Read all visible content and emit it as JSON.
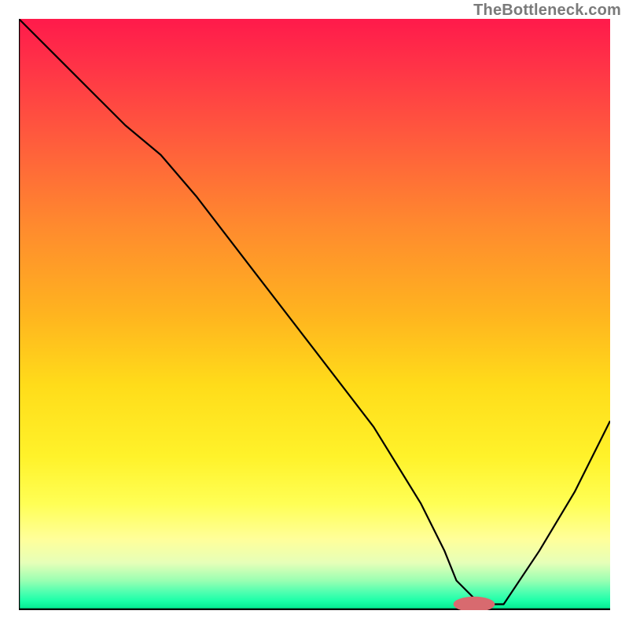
{
  "watermark": "TheBottleneck.com",
  "chart_data": {
    "type": "line",
    "title": "",
    "xlabel": "",
    "ylabel": "",
    "xlim": [
      0,
      100
    ],
    "ylim": [
      0,
      100
    ],
    "grid": false,
    "legend": false,
    "series": [
      {
        "name": "bottleneck-curve",
        "x": [
          0,
          8,
          18,
          24,
          30,
          40,
          50,
          60,
          68,
          72,
          74,
          78,
          82,
          88,
          94,
          100
        ],
        "values": [
          100,
          92,
          82,
          77,
          70,
          57,
          44,
          31,
          18,
          10,
          5,
          1,
          1,
          10,
          20,
          32
        ]
      }
    ],
    "plateau_range_x": [
      74,
      80
    ],
    "marker": {
      "x": 77,
      "y": 1,
      "rx": 3.5,
      "ry": 1.3,
      "color": "#d86a6f"
    },
    "background_gradient": {
      "top": "#ff1a4b",
      "upper_mid": "#ff8a2e",
      "mid": "#ffdc1a",
      "lower_mid": "#ffff9a",
      "bottom": "#00e58c"
    }
  }
}
